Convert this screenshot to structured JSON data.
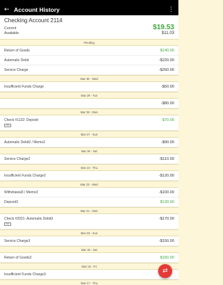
{
  "appbar": {
    "title": "Account History",
    "back_icon": "←",
    "menu_icon": "⋮"
  },
  "account": {
    "name": "Checking Account 2114",
    "current_label": "Current",
    "current_value": "$19.53",
    "available_label": "Available",
    "available_value": "$11.03"
  },
  "sections": [
    {
      "header": "Pending"
    },
    {
      "row": {
        "desc": "Return of Goods",
        "amount": "$140.00",
        "positive": true
      }
    },
    {
      "row": {
        "desc": "Automatic Debit",
        "amount": "-$220.00"
      }
    },
    {
      "row": {
        "desc": "Service Charge",
        "amount": "-$260.00"
      }
    },
    {
      "header": "Mar 30 - Wed"
    },
    {
      "row": {
        "desc": "Insufficient Funds Charge",
        "amount": "-$50.00"
      }
    },
    {
      "header": "Mar 29 - Tue"
    },
    {
      "row": {
        "desc": "",
        "amount": "-$80.00"
      }
    },
    {
      "header": "Mar 28 - Mon"
    },
    {
      "row": {
        "desc": "Check #1132: Deposit",
        "amount": "$70.00",
        "positive": true,
        "check": true
      }
    },
    {
      "header": "Mar 27 - Sun"
    },
    {
      "row": {
        "desc": "Automatic Debit2 / Memo2",
        "amount": "-$90.00"
      }
    },
    {
      "header": "Mar 26 - Sat"
    },
    {
      "row": {
        "desc": "Service Charge2",
        "amount": "-$110.00"
      }
    },
    {
      "header": "Mar 24 - Thu"
    },
    {
      "row": {
        "desc": "Insufficient Funds Charge2",
        "amount": "-$120.00"
      }
    },
    {
      "header": "Mar 23 - Wed"
    },
    {
      "row": {
        "desc": "Withdrawal3 / Memo3",
        "amount": "-$100.00"
      }
    },
    {
      "row": {
        "desc": "Deposit3",
        "amount": "$130.00",
        "positive": true
      }
    },
    {
      "header": "Mar 21 - Mon"
    },
    {
      "row": {
        "desc": "Check #2021: Automatic Debit3",
        "amount": "-$170.00",
        "check": true
      }
    },
    {
      "header": "Mar 20 - Sun"
    },
    {
      "row": {
        "desc": "Service Charge3",
        "amount": "-$150.00"
      }
    },
    {
      "header": "Mar 19 - Sat"
    },
    {
      "row": {
        "desc": "Return of Goods2",
        "amount": "$160.00",
        "positive": true
      }
    },
    {
      "header": "Mar 18 - Fri"
    },
    {
      "row": {
        "desc": "Insufficient Funds Charge3",
        "amount": ""
      }
    },
    {
      "header": "Mar 17 - Thu"
    }
  ],
  "check_icon_label": "IMG",
  "fab": {
    "icon": "transfer-icon",
    "glyph": "⇄"
  }
}
